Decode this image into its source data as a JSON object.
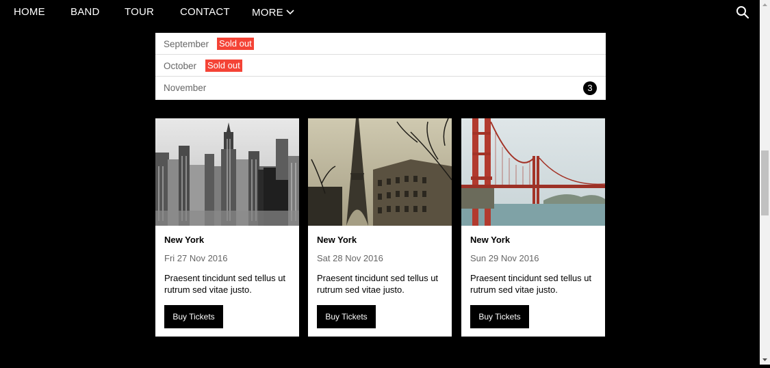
{
  "nav": {
    "items": [
      "HOME",
      "BAND",
      "TOUR",
      "CONTACT"
    ],
    "more_label": "MORE",
    "search_icon": "search-icon",
    "more_icon": "chevron-down-icon"
  },
  "months": [
    {
      "name": "September",
      "badge": "Sold out"
    },
    {
      "name": "October",
      "badge": "Sold out"
    },
    {
      "name": "November",
      "count": "3"
    }
  ],
  "cards": [
    {
      "title": "New York",
      "date": "Fri 27 Nov 2016",
      "text": "Praesent tincidunt sed tellus ut rutrum sed vitae justo.",
      "button": "Buy Tickets"
    },
    {
      "title": "New York",
      "date": "Sat 28 Nov 2016",
      "text": "Praesent tincidunt sed tellus ut rutrum sed vitae justo.",
      "button": "Buy Tickets"
    },
    {
      "title": "New York",
      "date": "Sun 29 Nov 2016",
      "text": "Praesent tincidunt sed tellus ut rutrum sed vitae justo.",
      "button": "Buy Tickets"
    }
  ],
  "colors": {
    "background": "#000000",
    "sold_out": "#f44336",
    "button": "#000000"
  }
}
